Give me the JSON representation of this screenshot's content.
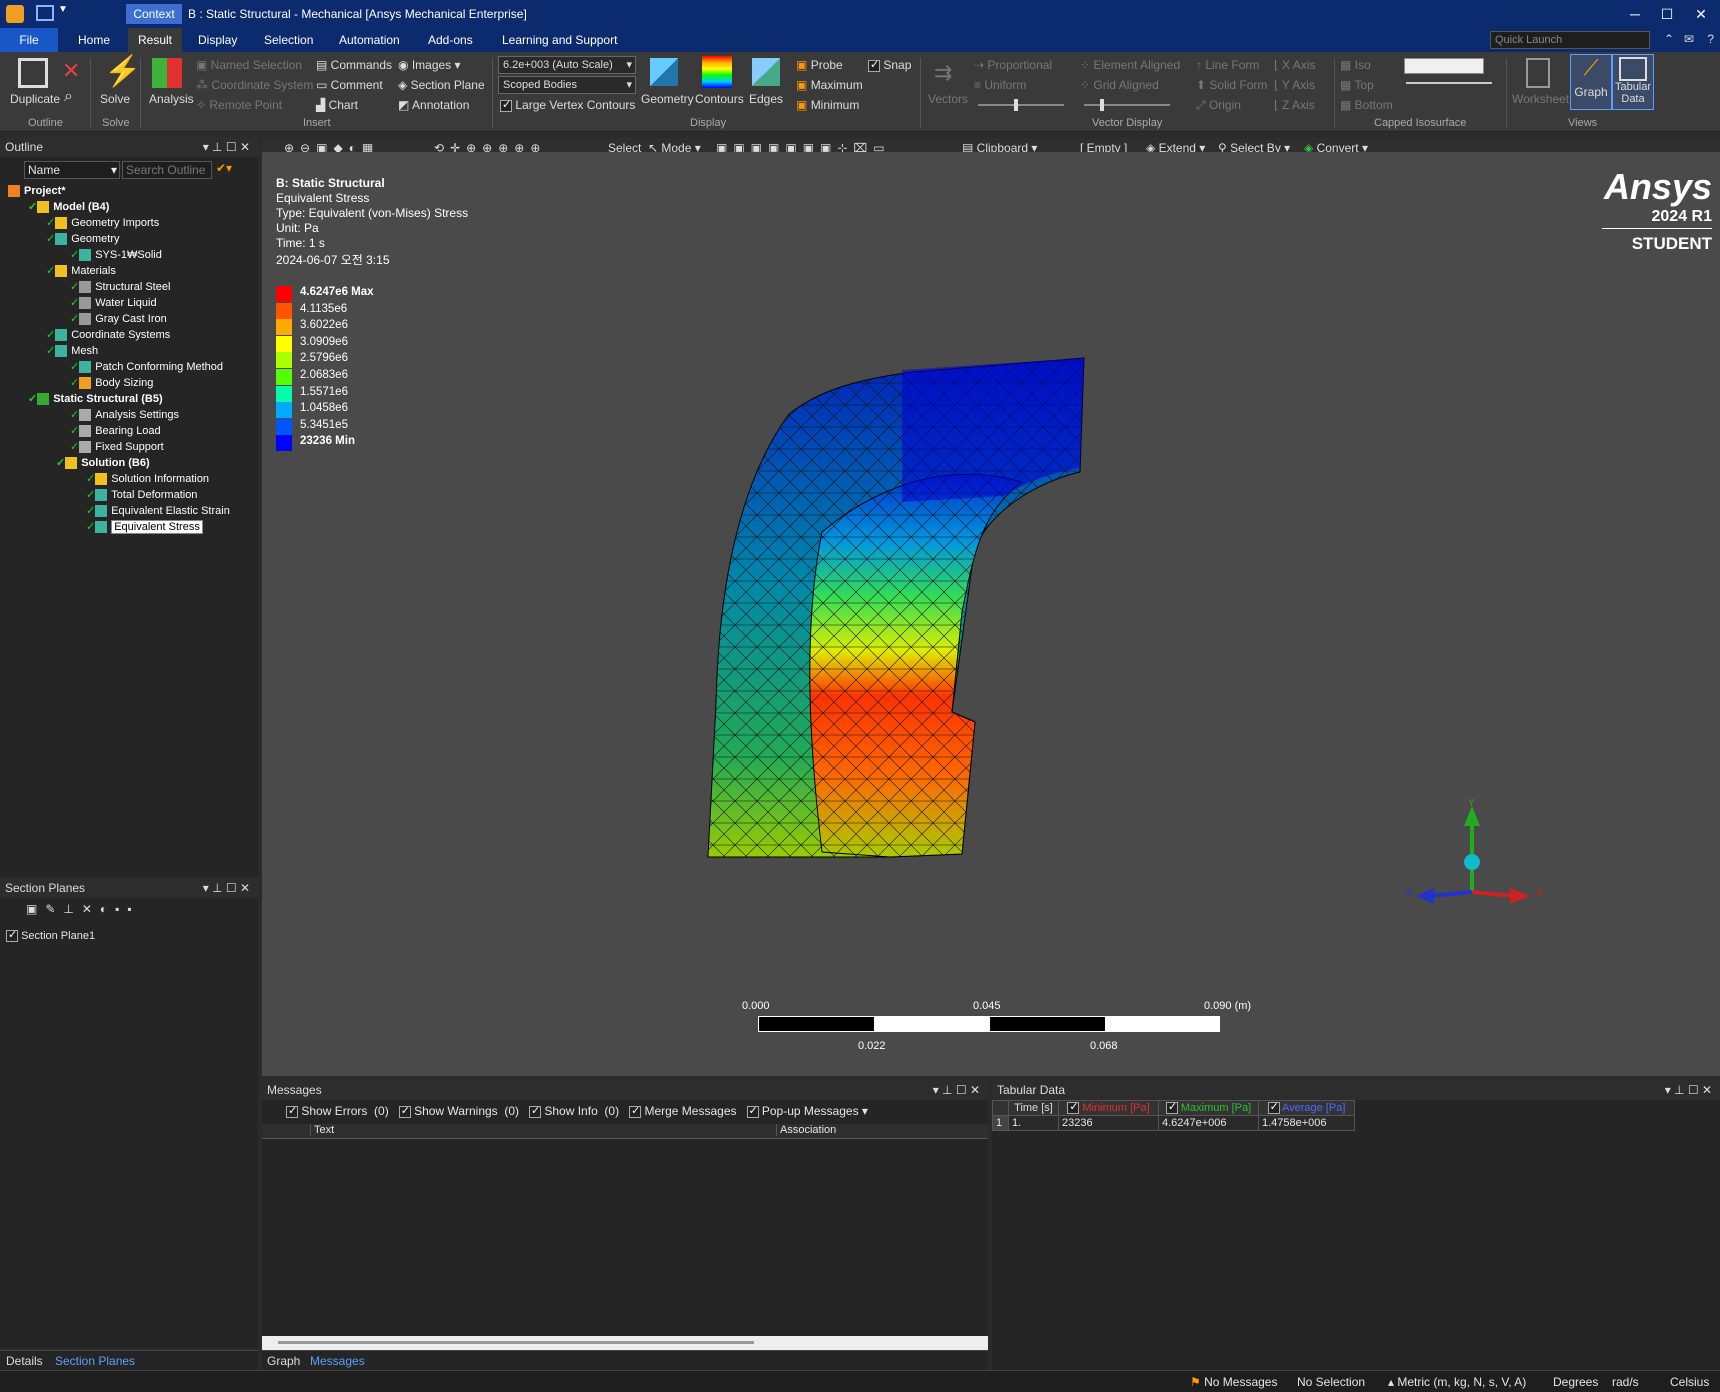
{
  "titlebar": {
    "context_tab": "Context",
    "title": "B : Static Structural - Mechanical [Ansys Mechanical Enterprise]"
  },
  "menu": {
    "tabs": [
      "File",
      "Home",
      "Result",
      "Display",
      "Selection",
      "Automation",
      "Add-ons",
      "Learning and Support"
    ],
    "active": "Result",
    "quick_launch_placeholder": "Quick Launch"
  },
  "ribbon": {
    "outline_group": {
      "duplicate": "Duplicate",
      "label": "Outline"
    },
    "solve_group": {
      "solve": "Solve",
      "label": "Solve"
    },
    "insert_group": {
      "analysis": "Analysis",
      "named_selection": "Named Selection",
      "coordinate_system": "Coordinate System",
      "remote_point": "Remote Point",
      "commands": "Commands",
      "comment": "Comment",
      "chart": "Chart",
      "images": "Images",
      "section_plane": "Section Plane",
      "annotation": "Annotation",
      "label": "Insert"
    },
    "display_group": {
      "scale_combo": "6.2e+003 (Auto Scale)",
      "scope_combo": "Scoped Bodies",
      "large_vertex_contours": "Large Vertex Contours",
      "geometry": "Geometry",
      "contours": "Contours",
      "edges": "Edges",
      "probe": "Probe",
      "maximum": "Maximum",
      "minimum": "Minimum",
      "snap": "Snap",
      "label": "Display"
    },
    "vector_group": {
      "vectors": "Vectors",
      "proportional": "Proportional",
      "uniform": "Uniform",
      "element_aligned": "Element Aligned",
      "grid_aligned": "Grid Aligned",
      "line_form": "Line Form",
      "solid_form": "Solid Form",
      "origin": "Origin",
      "x_axis": "X Axis",
      "y_axis": "Y Axis",
      "z_axis": "Z Axis",
      "label": "Vector Display"
    },
    "iso_group": {
      "iso": "Iso",
      "top": "Top",
      "bottom": "Bottom",
      "label": "Capped Isosurface"
    },
    "views_group": {
      "worksheet": "Worksheet",
      "graph": "Graph",
      "tabular": "Tabular",
      "tabular2": "Data",
      "label": "Views"
    }
  },
  "outline": {
    "header": "Outline",
    "name_combo": "Name",
    "search_placeholder": "Search Outline",
    "items": [
      {
        "label": "Project*",
        "bold": true
      },
      {
        "label": "Model (B4)",
        "bold": true
      },
      {
        "label": "Geometry Imports"
      },
      {
        "label": "Geometry"
      },
      {
        "label": "SYS-1₩Solid"
      },
      {
        "label": "Materials"
      },
      {
        "label": "Structural Steel"
      },
      {
        "label": "Water Liquid"
      },
      {
        "label": "Gray Cast Iron"
      },
      {
        "label": "Coordinate Systems"
      },
      {
        "label": "Mesh"
      },
      {
        "label": "Patch Conforming Method"
      },
      {
        "label": "Body Sizing"
      },
      {
        "label": "Static Structural (B5)",
        "bold": true
      },
      {
        "label": "Analysis Settings"
      },
      {
        "label": "Bearing Load"
      },
      {
        "label": "Fixed Support"
      },
      {
        "label": "Solution (B6)",
        "bold": true
      },
      {
        "label": "Solution Information"
      },
      {
        "label": "Total Deformation"
      },
      {
        "label": "Equivalent Elastic Strain"
      },
      {
        "label": "Equivalent Stress",
        "selected": true
      }
    ]
  },
  "section_planes": {
    "header": "Section Planes",
    "item": "Section Plane1"
  },
  "left_tabs": [
    "Details",
    "Section Planes"
  ],
  "view_toolbar": {
    "select": "Select",
    "mode": "Mode",
    "clipboard": "Clipboard",
    "empty": "[ Empty ]",
    "extend": "Extend",
    "select_by": "Select By",
    "convert": "Convert"
  },
  "result_info": {
    "title": "B: Static Structural",
    "name": "Equivalent Stress",
    "type": "Type: Equivalent (von-Mises) Stress",
    "unit": "Unit: Pa",
    "time": "Time: 1 s",
    "date": "2024-06-07 오전 3:15"
  },
  "legend": {
    "labels": [
      "4.6247e6 Max",
      "4.1135e6",
      "3.6022e6",
      "3.0909e6",
      "2.5796e6",
      "2.0683e6",
      "1.5571e6",
      "1.0458e6",
      "5.3451e5",
      "23236 Min"
    ],
    "colors": [
      "#ff0000",
      "#ff5500",
      "#ffaa00",
      "#ffff00",
      "#aaff00",
      "#55ff00",
      "#00ffaa",
      "#00aaff",
      "#0055ff",
      "#0000ff"
    ]
  },
  "brand": {
    "name": "Ansys",
    "version": "2024 R1",
    "edition": "STUDENT"
  },
  "scale_bar": {
    "top": [
      "0.000",
      "0.045",
      "0.090 (m)"
    ],
    "bottom": [
      "0.022",
      "0.068"
    ]
  },
  "triad": {
    "x": "X",
    "y": "Y",
    "z": "Z"
  },
  "messages": {
    "header": "Messages",
    "show_errors": "Show Errors",
    "errors_count": "(0)",
    "show_warnings": "Show Warnings",
    "warnings_count": "(0)",
    "show_info": "Show Info",
    "info_count": "(0)",
    "merge": "Merge Messages",
    "popup": "Pop-up Messages",
    "col_text": "Text",
    "col_assoc": "Association"
  },
  "bottom_tabs": [
    "Graph",
    "Messages"
  ],
  "tabular": {
    "header": "Tabular Data",
    "columns": [
      "Time [s]",
      "Minimum [Pa]",
      "Maximum [Pa]",
      "Average [Pa]"
    ],
    "row_index": "1",
    "row": [
      "1.",
      "23236",
      "4.6247e+006",
      "1.4758e+006"
    ],
    "colors": {
      "min": "#e03030",
      "max": "#2ec02e",
      "avg": "#4a6cff"
    }
  },
  "status": {
    "messages": "No Messages",
    "selection": "No Selection",
    "units": "Metric (m, kg, N, s, V, A)",
    "angle": "Degrees",
    "rot": "rad/s",
    "temp": "Celsius"
  }
}
